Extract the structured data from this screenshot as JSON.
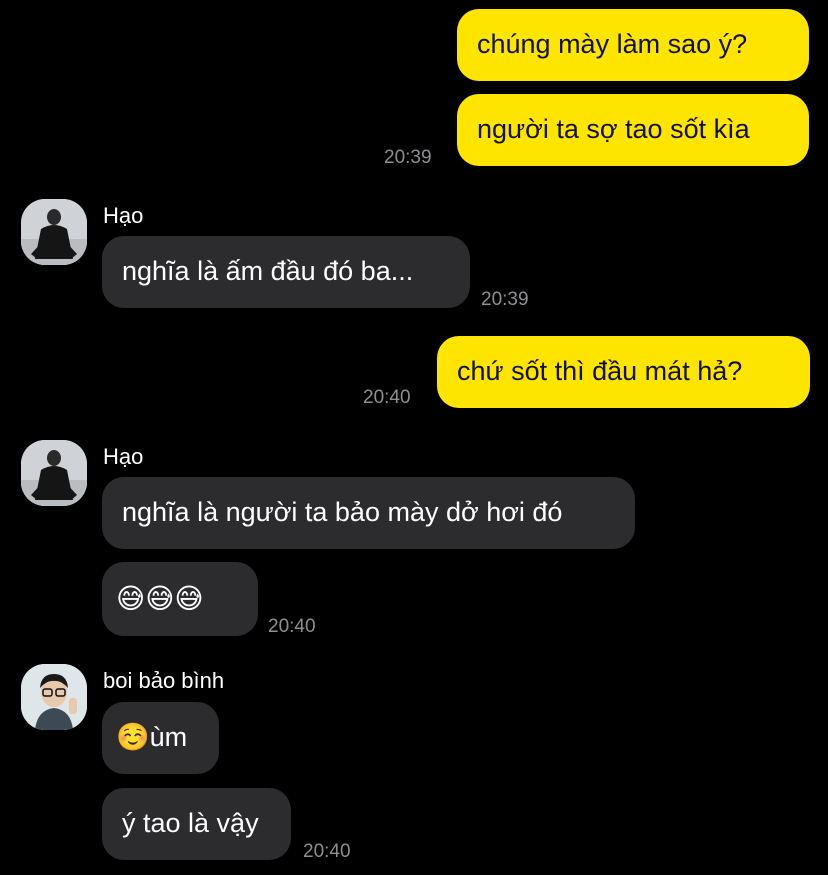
{
  "messages": {
    "m1": {
      "text": "chúng mày làm sao ý?"
    },
    "m2": {
      "text": "người ta sợ tao sốt kìa",
      "time": "20:39"
    },
    "m3": {
      "sender": "Hạo",
      "text": "nghĩa là ấm đầu đó ba...",
      "time": "20:39"
    },
    "m4": {
      "text": "chứ sốt thì đầu mát hả?",
      "time": "20:40"
    },
    "m5": {
      "sender": "Hạo",
      "text": "nghĩa là người ta bảo mày dở hơi đó"
    },
    "m6": {
      "text": "😅😅😅",
      "time": "20:40"
    },
    "m7": {
      "sender": "boi bảo bình",
      "text": "☺️ùm"
    },
    "m8": {
      "text": "ý tao là vậy",
      "time": "20:40"
    }
  },
  "colors": {
    "outgoing": "#FEE500",
    "incoming": "#2C2C2E",
    "background": "#000000",
    "timestamp": "#8E8E93"
  }
}
